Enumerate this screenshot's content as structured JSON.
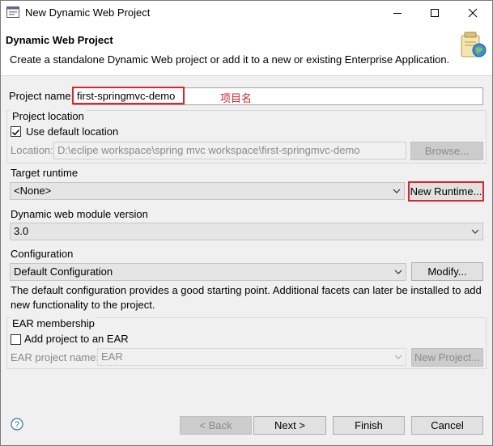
{
  "window": {
    "title": "New Dynamic Web Project",
    "controls": [
      "minimize-icon",
      "maximize-icon",
      "close-icon"
    ]
  },
  "header": {
    "title": "Dynamic Web Project",
    "description": "Create a standalone Dynamic Web project or add it to a new or existing Enterprise Application.",
    "image_icon": "wizard-banner-icon"
  },
  "project_name": {
    "label": "Project name:",
    "value": "first-springmvc-demo",
    "annotation": "项目名"
  },
  "location": {
    "group_label": "Project location",
    "use_default_label": "Use default location",
    "use_default_checked": true,
    "location_label": "Location:",
    "location_value": "D:\\eclipe workspace\\spring mvc workspace\\first-springmvc-demo",
    "browse_label": "Browse..."
  },
  "target_runtime": {
    "label": "Target runtime",
    "value": "<None>",
    "new_runtime_label": "New Runtime..."
  },
  "module_version": {
    "label": "Dynamic web module version",
    "value": "3.0"
  },
  "configuration": {
    "label": "Configuration",
    "value": "Default Configuration",
    "modify_label": "Modify...",
    "description": "The default configuration provides a good starting point. Additional facets can later be installed to add new functionality to the project."
  },
  "ear": {
    "group_label": "EAR membership",
    "add_label": "Add project to an EAR",
    "add_checked": false,
    "name_label": "EAR project name:",
    "name_value": "EAR",
    "new_project_label": "New Project..."
  },
  "footer": {
    "help_icon": "help-icon",
    "back_label": "< Back",
    "next_label": "Next >",
    "finish_label": "Finish",
    "cancel_label": "Cancel"
  },
  "colors": {
    "highlight_red": "#d9252d",
    "dialog_bg": "#f0f0f0",
    "header_bg": "#ffffff"
  }
}
